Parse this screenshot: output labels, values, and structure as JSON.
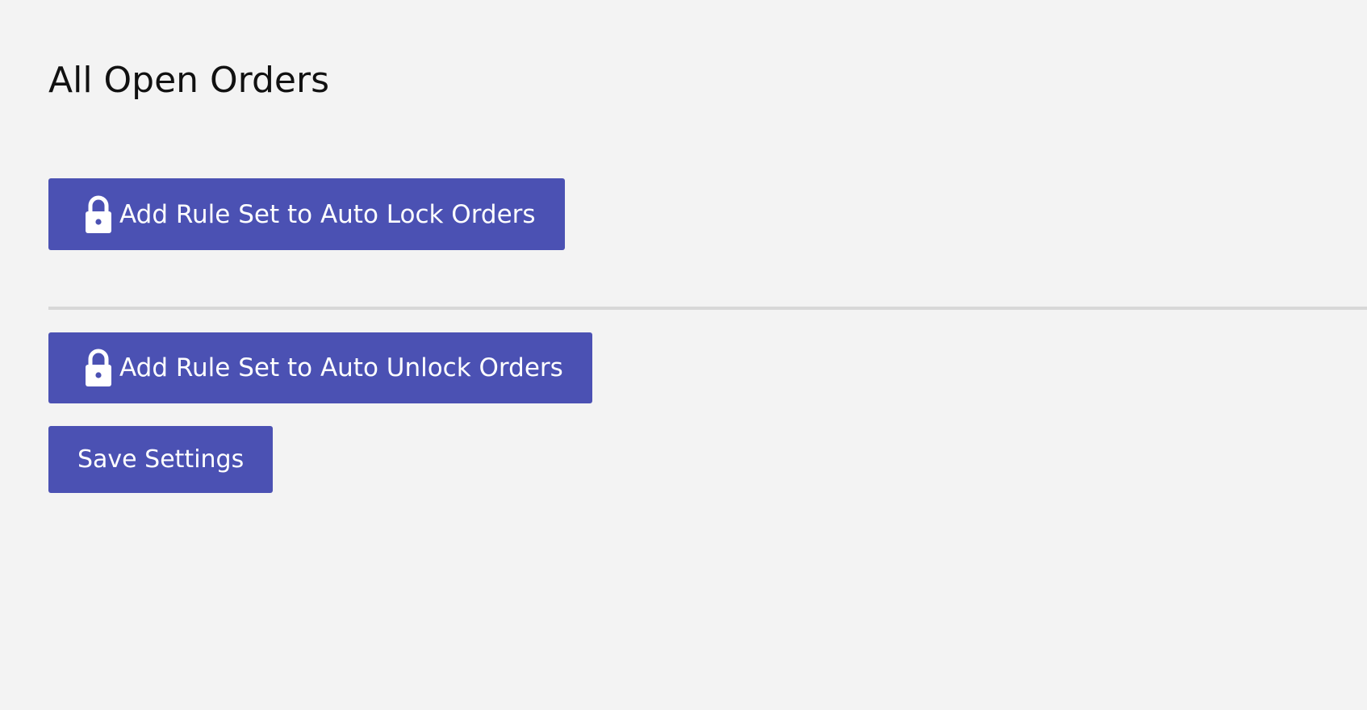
{
  "page": {
    "title": "All Open Orders"
  },
  "actions": {
    "auto_lock_label": "Add Rule Set to Auto Lock Orders",
    "auto_lock_icon": "lock-icon",
    "auto_unlock_label": "Add Rule Set to Auto Unlock Orders",
    "auto_unlock_icon": "unlock-icon",
    "save_label": "Save Settings"
  },
  "colors": {
    "background": "#f3f3f3",
    "button": "#4b51b3",
    "button_text": "#ffffff",
    "divider": "#d8d8d8",
    "title_text": "#111111"
  }
}
